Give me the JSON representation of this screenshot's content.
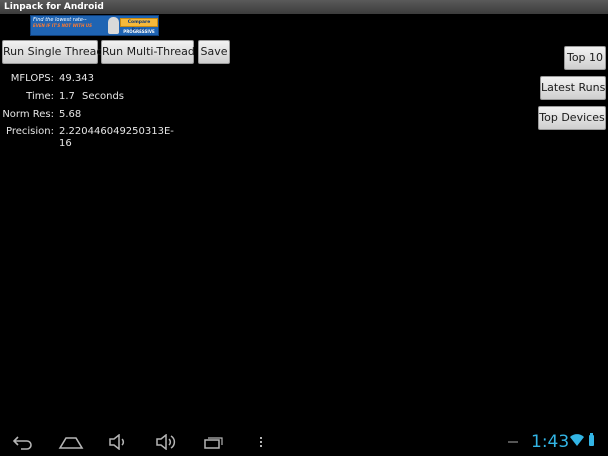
{
  "window": {
    "title": "Linpack for Android"
  },
  "ad": {
    "line1": "Find the lowest rate--",
    "line2": "EVEN IF IT'S NOT WITH US",
    "cta": "Compare Rates",
    "brand": "PROGRESSIVE"
  },
  "buttons": {
    "run_single": "Run Single Thread",
    "run_multi": "Run Multi-Thread",
    "save": "Save",
    "top10": "Top 10",
    "latest_runs": "Latest Runs",
    "top_devices": "Top Devices"
  },
  "results": {
    "mflops_label": "MFLOPS:",
    "mflops_value": "49.343",
    "time_label": "Time:",
    "time_value": "1.7",
    "time_unit": "Seconds",
    "normres_label": "Norm Res:",
    "normres_value": "5.68",
    "precision_label": "Precision:",
    "precision_value": "2.220446049250313E-16"
  },
  "statusbar": {
    "clock": "1:43"
  },
  "icons": {
    "back": "back-icon",
    "home": "home-icon",
    "volume_down": "volume-down-icon",
    "volume_up": "volume-up-icon",
    "recent": "recent-apps-icon",
    "menu": "menu-icon",
    "wifi": "wifi-icon",
    "battery": "battery-icon"
  },
  "colors": {
    "accent": "#33b5e5",
    "background": "#000000"
  }
}
